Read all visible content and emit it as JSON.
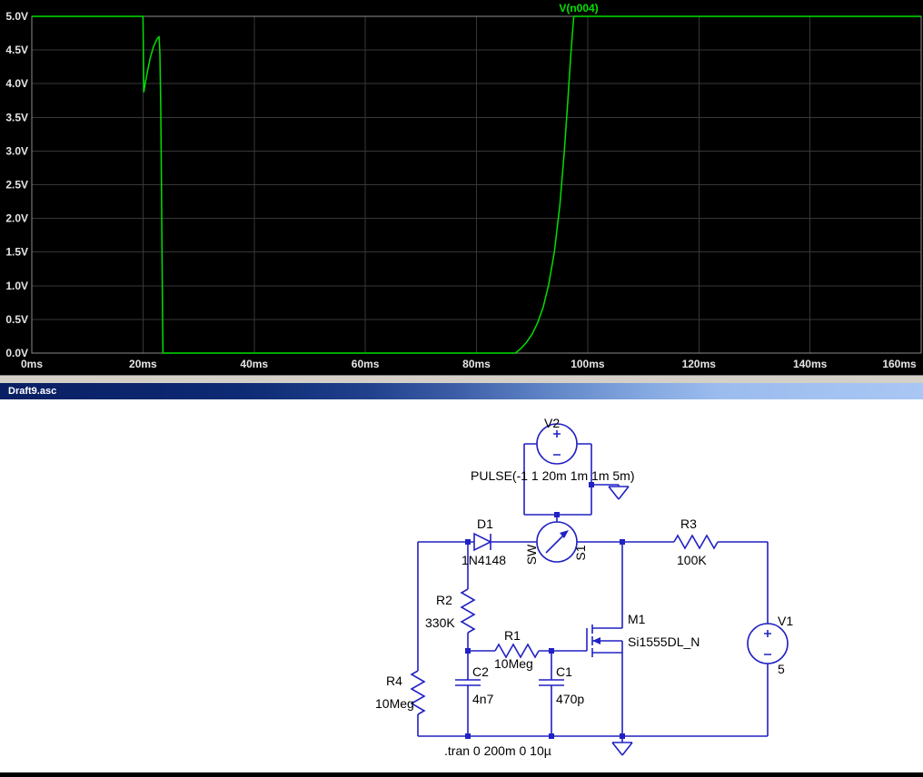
{
  "waveform": {
    "title": "V(n004)",
    "y_ticks": [
      "5.0V",
      "4.5V",
      "4.0V",
      "3.5V",
      "3.0V",
      "2.5V",
      "2.0V",
      "1.5V",
      "1.0V",
      "0.5V",
      "0.0V"
    ],
    "x_ticks": [
      "0ms",
      "20ms",
      "40ms",
      "60ms",
      "80ms",
      "100ms",
      "120ms",
      "140ms",
      "160ms"
    ],
    "trace_color": "#00e000",
    "bg_color": "#000000",
    "grid_color": "#373737",
    "frame_color": "#8c8c8c",
    "label_color": "#e6e6e6"
  },
  "chart_data": {
    "type": "line",
    "title": "V(n004)",
    "x_unit": "ms",
    "y_unit": "V",
    "xlim": [
      0,
      160
    ],
    "ylim": [
      0,
      5
    ],
    "grid": true,
    "legend_position": "top-center",
    "series": [
      {
        "name": "V(n004)",
        "points": [
          [
            0,
            5
          ],
          [
            20,
            5
          ],
          [
            20.15,
            3.88
          ],
          [
            20.4,
            4.0
          ],
          [
            20.8,
            4.18
          ],
          [
            21.3,
            4.38
          ],
          [
            21.9,
            4.55
          ],
          [
            22.5,
            4.66
          ],
          [
            22.9,
            4.7
          ],
          [
            23.05,
            4.45
          ],
          [
            23.2,
            3.6
          ],
          [
            23.35,
            2.2
          ],
          [
            23.5,
            0.7
          ],
          [
            23.6,
            0
          ],
          [
            87,
            0
          ],
          [
            88,
            0.07
          ],
          [
            89,
            0.16
          ],
          [
            90,
            0.28
          ],
          [
            91,
            0.45
          ],
          [
            92,
            0.68
          ],
          [
            93,
            1.02
          ],
          [
            94,
            1.5
          ],
          [
            95,
            2.2
          ],
          [
            95.8,
            3.0
          ],
          [
            96.4,
            3.7
          ],
          [
            96.9,
            4.35
          ],
          [
            97.3,
            4.8
          ],
          [
            97.5,
            5.0
          ],
          [
            160,
            5
          ]
        ]
      }
    ]
  },
  "title_bar": {
    "title": "Draft9.asc"
  },
  "schematic": {
    "wire_color": "#2121c4",
    "text_color": "#000000",
    "v2": {
      "ref": "V2",
      "value": "PULSE(-1 1 20m 1m 1m 5m)"
    },
    "s1": {
      "ref": "S1",
      "value": "SW"
    },
    "d1": {
      "ref": "D1",
      "value": "1N4148"
    },
    "r1": {
      "ref": "R1",
      "value": "10Meg"
    },
    "r2": {
      "ref": "R2",
      "value": "330K"
    },
    "r3": {
      "ref": "R3",
      "value": "100K"
    },
    "r4": {
      "ref": "R4",
      "value": "10Meg"
    },
    "c1": {
      "ref": "C1",
      "value": "470p"
    },
    "c2": {
      "ref": "C2",
      "value": "4n7"
    },
    "m1": {
      "ref": "M1",
      "value": "Si1555DL_N"
    },
    "v1": {
      "ref": "V1",
      "value": "5"
    },
    "directive": ".tran 0 200m 0 10µ"
  }
}
